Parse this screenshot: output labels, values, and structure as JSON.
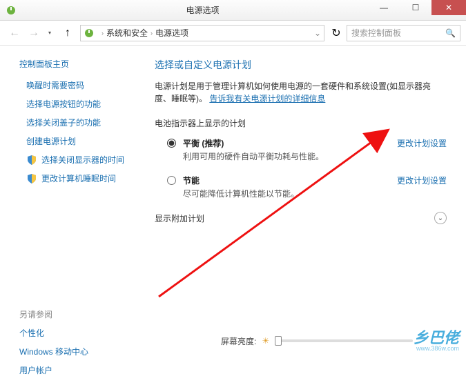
{
  "titlebar": {
    "title": "电源选项"
  },
  "win": {
    "min": "—",
    "max": "☐",
    "close": "✕"
  },
  "breadcrumb": {
    "items": [
      "系统和安全",
      "电源选项"
    ],
    "sep": "›",
    "dropdown": "⌄",
    "refresh": "↻"
  },
  "search": {
    "placeholder": "搜索控制面板"
  },
  "sidebar": {
    "heading": "控制面板主页",
    "links": [
      "唤醒时需要密码",
      "选择电源按钮的功能",
      "选择关闭盖子的功能",
      "创建电源计划",
      "选择关闭显示器的时间",
      "更改计算机睡眠时间"
    ],
    "see_also_heading": "另请参阅",
    "see_also": [
      "个性化",
      "Windows 移动中心",
      "用户帐户"
    ]
  },
  "page": {
    "title": "选择或自定义电源计划",
    "desc_pre": "电源计划是用于管理计算机如何使用电源的一套硬件和系统设置(如显示器亮度、睡眠等)。",
    "desc_link": "告诉我有关电源计划的详细信息",
    "section1": "电池指示器上显示的计划",
    "change_link": "更改计划设置",
    "plans": [
      {
        "name": "平衡 (推荐)",
        "desc": "利用可用的硬件自动平衡功耗与性能。",
        "checked": true
      },
      {
        "name": "节能",
        "desc": "尽可能降低计算机性能以节能。",
        "checked": false
      }
    ],
    "expand_label": "显示附加计划"
  },
  "bottom": {
    "brightness_label": "屏幕亮度:"
  },
  "watermark": {
    "text": "乡巴佬",
    "url": "www.386w.com"
  }
}
